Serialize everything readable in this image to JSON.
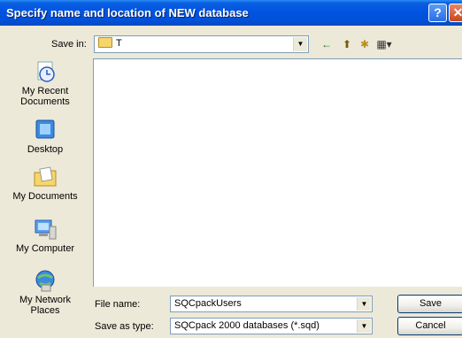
{
  "window": {
    "title": "Specify name and location of NEW database",
    "help_label": "?",
    "close_label": "✕"
  },
  "toolbar": {
    "save_in_label": "Save in:",
    "save_in_value": "T",
    "back_icon": "←",
    "up_icon": "⬆",
    "new_folder_icon": "✱",
    "views_icon": "▦▾"
  },
  "places": [
    {
      "label": "My Recent Documents",
      "icon": "recent-documents-icon"
    },
    {
      "label": "Desktop",
      "icon": "desktop-icon"
    },
    {
      "label": "My Documents",
      "icon": "my-documents-icon"
    },
    {
      "label": "My Computer",
      "icon": "my-computer-icon"
    },
    {
      "label": "My Network Places",
      "icon": "network-places-icon"
    }
  ],
  "form": {
    "file_name_label": "File name:",
    "file_name_value": "SQCpackUsers",
    "save_as_type_label": "Save as type:",
    "save_as_type_value": "SQCpack 2000 databases (*.sqd)"
  },
  "buttons": {
    "save": "Save",
    "cancel": "Cancel"
  }
}
